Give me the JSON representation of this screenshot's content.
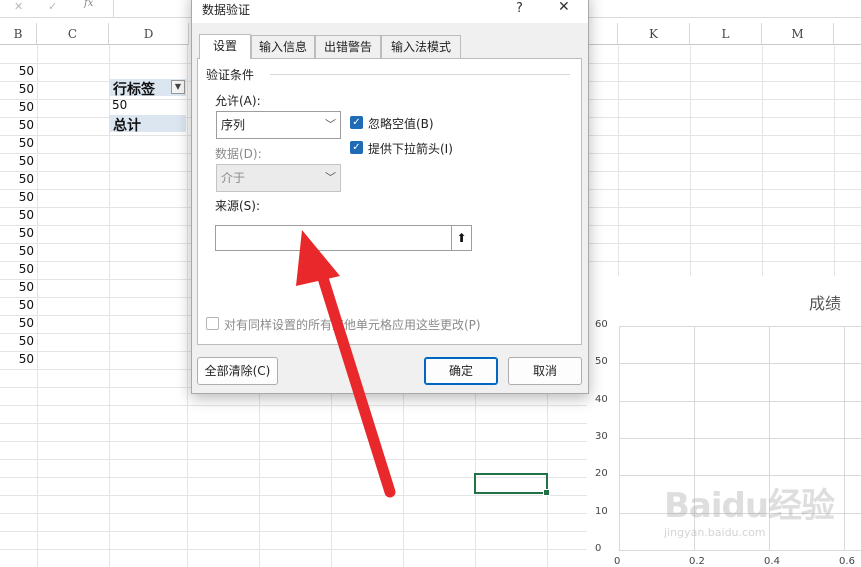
{
  "formula_bar": {
    "cancel_icon": "x-icon",
    "enter_icon": "check-icon",
    "fx_label": "fx"
  },
  "columns": [
    "B",
    "C",
    "D",
    "K",
    "L",
    "M"
  ],
  "column_b_values": [
    "50",
    "50",
    "50",
    "50",
    "50",
    "50",
    "50",
    "50",
    "50",
    "50",
    "50",
    "50",
    "50",
    "50",
    "50",
    "50",
    "50"
  ],
  "pivot": {
    "row_label_header": "行标签",
    "item": "50",
    "total": "总计"
  },
  "chart": {
    "title": "成绩",
    "colors": {
      "grid": "#d9d9d9",
      "text": "#444444"
    }
  },
  "chart_data": {
    "type": "scatter",
    "title": "成绩",
    "xlabel": "",
    "ylabel": "",
    "x_ticks": [
      "0",
      "0.2",
      "0.4",
      "0.6"
    ],
    "y_ticks": [
      "0",
      "10",
      "20",
      "30",
      "40",
      "50",
      "60"
    ],
    "xlim": [
      0,
      0.6
    ],
    "ylim": [
      0,
      60
    ],
    "grid": true,
    "series": []
  },
  "watermark": {
    "text": "Baidu经验",
    "sub": "jingyan.baidu.com"
  },
  "dialog": {
    "title": "数据验证",
    "help_label": "?",
    "close_label": "✕",
    "tabs": [
      "设置",
      "输入信息",
      "出错警告",
      "输入法模式"
    ],
    "group_label": "验证条件",
    "allow_label": "允许(A):",
    "allow_value": "序列",
    "data_label": "数据(D):",
    "data_value": "介于",
    "ignore_blank_label": "忽略空值(B)",
    "dropdown_arrow_label": "提供下拉箭头(I)",
    "source_label": "来源(S):",
    "source_value": "",
    "apply_all_label": "对有同样设置的所有其他单元格应用这些更改(P)",
    "clear_all_label": "全部清除(C)",
    "ok_label": "确定",
    "cancel_label": "取消",
    "accent_color": "#1f6bb6"
  },
  "annotation": {
    "arrow_color": "#e8282b"
  }
}
